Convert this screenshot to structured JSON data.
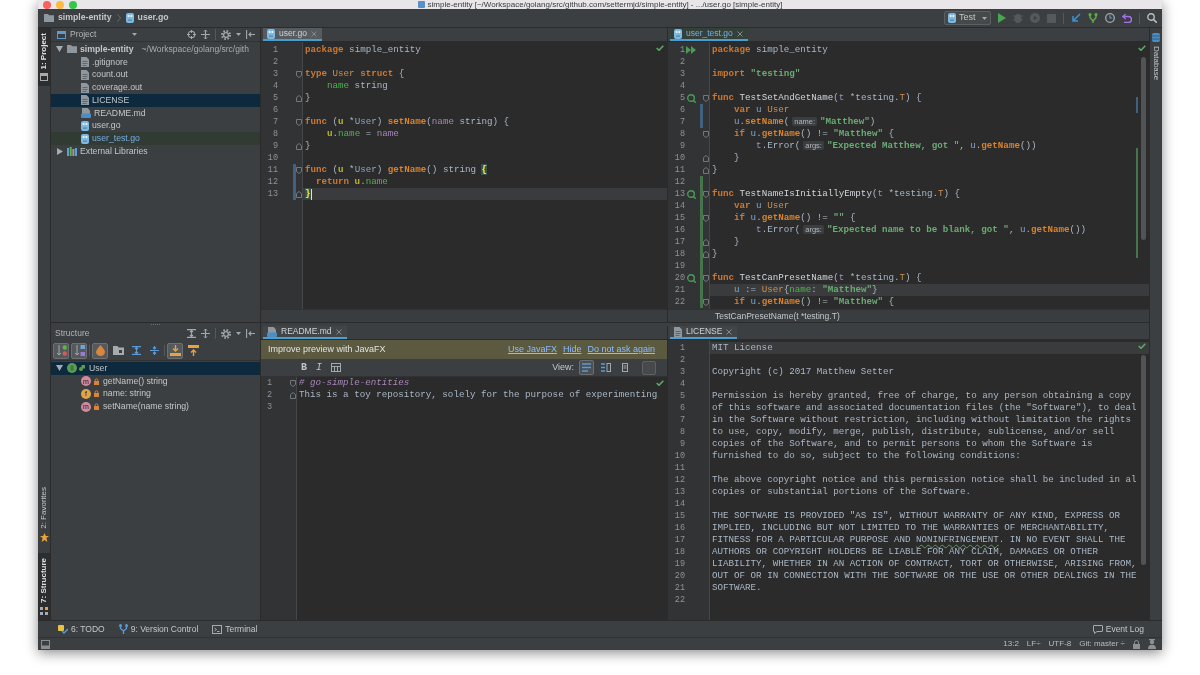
{
  "window": {
    "title": "simple-entity [~/Workspace/golang/src/github.com/settermjd/simple-entity] - .../user.go [simple-entity]"
  },
  "navigation_bar": {
    "breadcrumbs": [
      {
        "label": "simple-entity",
        "kind": "folder"
      },
      {
        "label": "user.go",
        "kind": "go"
      }
    ],
    "run_configuration": {
      "label": "Test"
    }
  },
  "left_stripe": [
    {
      "label": "1: Project",
      "selected": true
    },
    {
      "label": "2: Favorites",
      "selected": false
    },
    {
      "label": "7: Structure",
      "selected": true
    }
  ],
  "right_stripe": [
    {
      "label": "Database",
      "selected": false
    }
  ],
  "project": {
    "title": "Project",
    "tree": [
      {
        "label": "simple-entity",
        "kind": "folder",
        "path": "~/Workspace/golang/src/gith",
        "expanded": true,
        "selected": false,
        "children": [
          {
            "label": ".gitignore",
            "kind": "text",
            "selected": false,
            "modified": false,
            "test": false
          },
          {
            "label": "count.out",
            "kind": "text",
            "selected": false,
            "modified": false,
            "test": false
          },
          {
            "label": "coverage.out",
            "kind": "text",
            "selected": false,
            "modified": false,
            "test": false
          },
          {
            "label": "LICENSE",
            "kind": "text",
            "selected": true,
            "modified": false,
            "test": false
          },
          {
            "label": "README.md",
            "kind": "markdown",
            "selected": false,
            "modified": false,
            "test": false
          },
          {
            "label": "user.go",
            "kind": "go",
            "selected": false,
            "modified": false,
            "test": false
          },
          {
            "label": "user_test.go",
            "kind": "go",
            "selected": false,
            "modified": true,
            "test": true
          }
        ]
      },
      {
        "label": "External Libraries",
        "kind": "library",
        "expanded": false,
        "selected": false
      }
    ]
  },
  "structure": {
    "title": "Structure",
    "toolbar": [
      {
        "pressed": true
      },
      {
        "pressed": true
      },
      {
        "pressed": true
      },
      {
        "pressed": false
      },
      {
        "pressed": false
      },
      {
        "pressed": false
      },
      {
        "pressed": true
      },
      {
        "pressed": false
      }
    ],
    "tree": [
      {
        "label": "User",
        "kind": "struct",
        "selected": true,
        "expanded": true,
        "children": [
          {
            "label": "getName() string",
            "kind": "method",
            "badge": "m",
            "selected": false
          },
          {
            "label": "name: string",
            "kind": "field",
            "badge": "f",
            "selected": false
          },
          {
            "label": "setName(name string)",
            "kind": "method",
            "badge": "m",
            "selected": false
          }
        ]
      }
    ]
  },
  "editors": [
    {
      "tab": {
        "label": "user.go",
        "kind": "go",
        "selected": true,
        "modified": false,
        "test": false
      },
      "focused": true,
      "lines": [
        {
          "number": "1",
          "current": false,
          "tokens": [
            {
              "kind": "keyword",
              "text": "package"
            },
            {
              "kind": "plain",
              "text": " simple_entity"
            }
          ]
        },
        {
          "number": "2",
          "current": false
        },
        {
          "number": "3",
          "current": false,
          "markers": [
            {
              "kind": "fold_start"
            }
          ],
          "tokens": [
            {
              "kind": "keyword",
              "text": "type"
            },
            {
              "kind": "type_name",
              "text": " User"
            },
            {
              "kind": "keyword",
              "text": " struct"
            },
            {
              "kind": "plain",
              "text": " {"
            }
          ]
        },
        {
          "number": "4",
          "current": false,
          "tokens": [
            {
              "kind": "field",
              "text": "    name"
            },
            {
              "kind": "plain",
              "text": " string"
            }
          ]
        },
        {
          "number": "5",
          "current": false,
          "markers": [
            {
              "kind": "fold_end"
            }
          ],
          "tokens": [
            {
              "kind": "plain",
              "text": "}"
            }
          ]
        },
        {
          "number": "6",
          "current": false
        },
        {
          "number": "7",
          "current": false,
          "markers": [
            {
              "kind": "fold_start"
            }
          ],
          "tokens": [
            {
              "kind": "keyword",
              "text": "func"
            },
            {
              "kind": "plain",
              "text": " ("
            },
            {
              "kind": "receiver",
              "text": "u"
            },
            {
              "kind": "plain",
              "text": " *"
            },
            {
              "kind": "type_ref",
              "text": "User"
            },
            {
              "kind": "plain",
              "text": ") "
            },
            {
              "kind": "method",
              "text": "setName"
            },
            {
              "kind": "plain",
              "text": "("
            },
            {
              "kind": "param",
              "text": "name"
            },
            {
              "kind": "plain",
              "text": " string) {"
            }
          ]
        },
        {
          "number": "8",
          "current": false,
          "tokens": [
            {
              "kind": "receiver",
              "text": "    u"
            },
            {
              "kind": "plain",
              "text": "."
            },
            {
              "kind": "field",
              "text": "name"
            },
            {
              "kind": "plain",
              "text": " = "
            },
            {
              "kind": "param",
              "text": "name"
            }
          ]
        },
        {
          "number": "9",
          "current": false,
          "markers": [
            {
              "kind": "fold_end"
            }
          ],
          "tokens": [
            {
              "kind": "plain",
              "text": "}"
            }
          ]
        },
        {
          "number": "10",
          "current": false
        },
        {
          "number": "11",
          "current": false,
          "markers": [
            {
              "kind": "fold_start"
            },
            {
              "kind": "modified"
            }
          ],
          "tokens": [
            {
              "kind": "keyword",
              "text": "func"
            },
            {
              "kind": "plain",
              "text": " ("
            },
            {
              "kind": "receiver",
              "text": "u"
            },
            {
              "kind": "plain",
              "text": " *"
            },
            {
              "kind": "type_ref",
              "text": "User"
            },
            {
              "kind": "plain",
              "text": ") "
            },
            {
              "kind": "method",
              "text": "getName"
            },
            {
              "kind": "plain",
              "text": "() string "
            },
            {
              "kind": "brace",
              "text": "{"
            }
          ]
        },
        {
          "number": "12",
          "current": false,
          "markers": [
            {
              "kind": "modified"
            }
          ],
          "tokens": [
            {
              "kind": "keyword",
              "text": "  return"
            },
            {
              "kind": "receiver",
              "text": " u"
            },
            {
              "kind": "plain",
              "text": "."
            },
            {
              "kind": "field",
              "text": "name"
            }
          ]
        },
        {
          "number": "13",
          "current": true,
          "markers": [
            {
              "kind": "fold_end"
            },
            {
              "kind": "modified"
            }
          ],
          "tokens": [
            {
              "kind": "brace",
              "text": "}"
            }
          ]
        }
      ]
    },
    {
      "tab": {
        "label": "user_test.go",
        "kind": "go",
        "selected": true,
        "modified": true,
        "test": true
      },
      "focused": false,
      "breadcrumb": "TestCanPresetName(t *testing.T)",
      "lines": [
        {
          "number": "1",
          "current": false,
          "markers": [
            {
              "kind": "run_file"
            }
          ],
          "tokens": [
            {
              "kind": "keyword",
              "text": "package"
            },
            {
              "kind": "plain",
              "text": " simple_entity"
            }
          ]
        },
        {
          "number": "2",
          "current": false
        },
        {
          "number": "3",
          "current": false,
          "tokens": [
            {
              "kind": "keyword",
              "text": "import"
            },
            {
              "kind": "string",
              "text": " \"testing\""
            }
          ]
        },
        {
          "number": "4",
          "current": false
        },
        {
          "number": "5",
          "current": false,
          "markers": [
            {
              "kind": "run_test"
            },
            {
              "kind": "fold_start"
            }
          ],
          "tokens": [
            {
              "kind": "keyword",
              "text": "func"
            },
            {
              "kind": "func",
              "text": " TestSetAndGetName"
            },
            {
              "kind": "plain",
              "text": "("
            },
            {
              "kind": "param",
              "text": "t"
            },
            {
              "kind": "plain",
              "text": " *testing."
            },
            {
              "kind": "type_name",
              "text": "T"
            },
            {
              "kind": "plain",
              "text": ") {"
            }
          ]
        },
        {
          "number": "6",
          "current": false,
          "markers": [
            {
              "kind": "modified"
            }
          ],
          "tokens": [
            {
              "kind": "keyword",
              "text": "    var"
            },
            {
              "kind": "local",
              "text": " u"
            },
            {
              "kind": "type_name",
              "text": " User"
            }
          ]
        },
        {
          "number": "7",
          "current": false,
          "markers": [
            {
              "kind": "modified"
            }
          ],
          "tokens": [
            {
              "kind": "local",
              "text": "    u"
            },
            {
              "kind": "plain",
              "text": "."
            },
            {
              "kind": "method",
              "text": "setName"
            },
            {
              "kind": "plain",
              "text": "("
            },
            {
              "kind": "hint",
              "text": "name:"
            },
            {
              "kind": "string",
              "text": "\"Matthew\""
            },
            {
              "kind": "plain",
              "text": ")"
            }
          ]
        },
        {
          "number": "8",
          "current": false,
          "markers": [
            {
              "kind": "fold_start"
            }
          ],
          "tokens": [
            {
              "kind": "keyword",
              "text": "    if"
            },
            {
              "kind": "local",
              "text": " u"
            },
            {
              "kind": "plain",
              "text": "."
            },
            {
              "kind": "method",
              "text": "getName"
            },
            {
              "kind": "plain",
              "text": "() != "
            },
            {
              "kind": "string",
              "text": "\"Matthew\""
            },
            {
              "kind": "plain",
              "text": " {"
            }
          ]
        },
        {
          "number": "9",
          "current": false,
          "tokens": [
            {
              "kind": "param",
              "text": "        t"
            },
            {
              "kind": "plain",
              "text": ".Error("
            },
            {
              "kind": "hint",
              "text": "args:"
            },
            {
              "kind": "string",
              "text": "\"Expected Matthew, got \""
            },
            {
              "kind": "plain",
              "text": ", "
            },
            {
              "kind": "local",
              "text": "u"
            },
            {
              "kind": "plain",
              "text": "."
            },
            {
              "kind": "method",
              "text": "getName"
            },
            {
              "kind": "plain",
              "text": "())"
            }
          ]
        },
        {
          "number": "10",
          "current": false,
          "markers": [
            {
              "kind": "fold_end"
            }
          ],
          "tokens": [
            {
              "kind": "plain",
              "text": "    }"
            }
          ]
        },
        {
          "number": "11",
          "current": false,
          "markers": [
            {
              "kind": "fold_end"
            }
          ],
          "tokens": [
            {
              "kind": "plain",
              "text": "}"
            }
          ]
        },
        {
          "number": "12",
          "current": false,
          "markers": [
            {
              "kind": "added"
            }
          ]
        },
        {
          "number": "13",
          "current": false,
          "markers": [
            {
              "kind": "run_test"
            },
            {
              "kind": "added"
            },
            {
              "kind": "fold_start"
            }
          ],
          "tokens": [
            {
              "kind": "keyword",
              "text": "func"
            },
            {
              "kind": "func",
              "text": " TestNameIsInitiallyEmpty"
            },
            {
              "kind": "plain",
              "text": "("
            },
            {
              "kind": "param",
              "text": "t"
            },
            {
              "kind": "plain",
              "text": " *testing."
            },
            {
              "kind": "type_name",
              "text": "T"
            },
            {
              "kind": "plain",
              "text": ") {"
            }
          ]
        },
        {
          "number": "14",
          "current": false,
          "markers": [
            {
              "kind": "added"
            }
          ],
          "tokens": [
            {
              "kind": "keyword",
              "text": "    var"
            },
            {
              "kind": "local",
              "text": " u"
            },
            {
              "kind": "type_name",
              "text": " User"
            }
          ]
        },
        {
          "number": "15",
          "current": false,
          "markers": [
            {
              "kind": "added"
            },
            {
              "kind": "fold_start"
            }
          ],
          "tokens": [
            {
              "kind": "keyword",
              "text": "    if"
            },
            {
              "kind": "local",
              "text": " u"
            },
            {
              "kind": "plain",
              "text": "."
            },
            {
              "kind": "method",
              "text": "getName"
            },
            {
              "kind": "plain",
              "text": "() != "
            },
            {
              "kind": "string",
              "text": "\"\""
            },
            {
              "kind": "plain",
              "text": " {"
            }
          ]
        },
        {
          "number": "16",
          "current": false,
          "markers": [
            {
              "kind": "added"
            }
          ],
          "tokens": [
            {
              "kind": "param",
              "text": "        t"
            },
            {
              "kind": "plain",
              "text": ".Error("
            },
            {
              "kind": "hint",
              "text": "args:"
            },
            {
              "kind": "string",
              "text": "\"Expected name to be blank, got \""
            },
            {
              "kind": "plain",
              "text": ", "
            },
            {
              "kind": "local",
              "text": "u"
            },
            {
              "kind": "plain",
              "text": "."
            },
            {
              "kind": "method",
              "text": "getName"
            },
            {
              "kind": "plain",
              "text": "())"
            }
          ]
        },
        {
          "number": "17",
          "current": false,
          "markers": [
            {
              "kind": "added"
            },
            {
              "kind": "fold_end"
            }
          ],
          "tokens": [
            {
              "kind": "plain",
              "text": "    }"
            }
          ]
        },
        {
          "number": "18",
          "current": false,
          "markers": [
            {
              "kind": "added"
            },
            {
              "kind": "fold_end"
            }
          ],
          "tokens": [
            {
              "kind": "plain",
              "text": "}"
            }
          ]
        },
        {
          "number": "19",
          "current": false,
          "markers": [
            {
              "kind": "added"
            }
          ]
        },
        {
          "number": "20",
          "current": false,
          "markers": [
            {
              "kind": "run_test"
            },
            {
              "kind": "added"
            },
            {
              "kind": "fold_start"
            }
          ],
          "tokens": [
            {
              "kind": "keyword",
              "text": "func"
            },
            {
              "kind": "func",
              "text": " TestCanPresetName"
            },
            {
              "kind": "plain",
              "text": "("
            },
            {
              "kind": "param",
              "text": "t"
            },
            {
              "kind": "plain",
              "text": " *testing."
            },
            {
              "kind": "type_name",
              "text": "T"
            },
            {
              "kind": "plain",
              "text": ") {"
            }
          ]
        },
        {
          "number": "21",
          "current": true,
          "markers": [
            {
              "kind": "added"
            }
          ],
          "tokens": [
            {
              "kind": "local",
              "text": "    u"
            },
            {
              "kind": "plain",
              "text": " := "
            },
            {
              "kind": "type_name",
              "text": "User"
            },
            {
              "kind": "plain",
              "text": "{"
            },
            {
              "kind": "field",
              "text": "name"
            },
            {
              "kind": "plain",
              "text": ": "
            },
            {
              "kind": "string",
              "text": "\"Matthew\""
            },
            {
              "kind": "plain",
              "text": "}"
            }
          ]
        },
        {
          "number": "22",
          "current": false,
          "markers": [
            {
              "kind": "added"
            },
            {
              "kind": "fold_start"
            }
          ],
          "tokens": [
            {
              "kind": "keyword",
              "text": "    if"
            },
            {
              "kind": "local",
              "text": " u"
            },
            {
              "kind": "plain",
              "text": "."
            },
            {
              "kind": "method",
              "text": "getName"
            },
            {
              "kind": "plain",
              "text": "() != "
            },
            {
              "kind": "string",
              "text": "\"Matthew\""
            },
            {
              "kind": "plain",
              "text": " {"
            }
          ]
        }
      ]
    },
    {
      "tab": {
        "label": "README.md",
        "kind": "markdown",
        "selected": true,
        "modified": false,
        "test": false
      },
      "focused": false,
      "notification": {
        "message": "Improve preview with JavaFX",
        "links": [
          "Use JavaFX",
          "Hide",
          "Do not ask again"
        ]
      },
      "toolbar": {
        "format_buttons": [
          {
            "label": "B",
            "kind": "bold"
          },
          {
            "label": "I",
            "kind": "italic"
          }
        ],
        "view_label": "View:",
        "view_modes": [
          {
            "selected": true
          },
          {
            "selected": false
          },
          {
            "selected": false
          }
        ]
      },
      "lines": [
        {
          "number": "1",
          "current": false,
          "markers": [
            {
              "kind": "fold_start"
            }
          ],
          "tokens": [
            {
              "kind": "heading",
              "text": "# go-simple-entities"
            }
          ]
        },
        {
          "number": "2",
          "current": false,
          "markers": [
            {
              "kind": "fold_end"
            }
          ],
          "text": "This is a toy repository, solely for the purpose of experimenting"
        },
        {
          "number": "3",
          "current": false
        }
      ]
    },
    {
      "tab": {
        "label": "LICENSE",
        "kind": "text",
        "selected": true,
        "modified": false,
        "test": false
      },
      "focused": false,
      "lines": [
        {
          "number": "1",
          "current": true,
          "text": "MIT License"
        },
        {
          "number": "2",
          "current": false
        },
        {
          "number": "3",
          "current": false,
          "text": "Copyright (c) 2017 Matthew Setter"
        },
        {
          "number": "4",
          "current": false
        },
        {
          "number": "5",
          "current": false,
          "text": "Permission is hereby granted, free of charge, to any person obtaining a copy"
        },
        {
          "number": "6",
          "current": false,
          "text": "of this software and associated documentation files (the \"Software\"), to deal"
        },
        {
          "number": "7",
          "current": false,
          "text": "in the Software without restriction, including without limitation the rights"
        },
        {
          "number": "8",
          "current": false,
          "text": "to use, copy, modify, merge, publish, distribute, sublicense, and/or sell"
        },
        {
          "number": "9",
          "current": false,
          "text": "copies of the Software, and to permit persons to whom the Software is"
        },
        {
          "number": "10",
          "current": false,
          "text": "furnished to do so, subject to the following conditions:"
        },
        {
          "number": "11",
          "current": false
        },
        {
          "number": "12",
          "current": false,
          "text": "The above copyright notice and this permission notice shall be included in al"
        },
        {
          "number": "13",
          "current": false,
          "text": "copies or substantial portions of the Software."
        },
        {
          "number": "14",
          "current": false
        },
        {
          "number": "15",
          "current": false,
          "text": "THE SOFTWARE IS PROVIDED \"AS IS\", WITHOUT WARRANTY OF ANY KIND, EXPRESS OR"
        },
        {
          "number": "16",
          "current": false,
          "text": "IMPLIED, INCLUDING BUT NOT LIMITED TO THE WARRANTIES OF MERCHANTABILITY,"
        },
        {
          "number": "17",
          "current": false,
          "tokens": [
            {
              "kind": "plain",
              "text": "FITNESS FOR A PARTICULAR PURPOSE AND "
            },
            {
              "kind": "typo",
              "text": "NONINFRINGEMENT"
            },
            {
              "kind": "plain",
              "text": ". IN NO EVENT SHALL THE"
            }
          ]
        },
        {
          "number": "18",
          "current": false,
          "text": "AUTHORS OR COPYRIGHT HOLDERS BE LIABLE FOR ANY CLAIM, DAMAGES OR OTHER"
        },
        {
          "number": "19",
          "current": false,
          "text": "LIABILITY, WHETHER IN AN ACTION OF CONTRACT, TORT OR OTHERWISE, ARISING FROM,"
        },
        {
          "number": "20",
          "current": false,
          "text": "OUT OF OR IN CONNECTION WITH THE SOFTWARE OR THE USE OR OTHER DEALINGS IN THE"
        },
        {
          "number": "21",
          "current": false,
          "text": "SOFTWARE."
        },
        {
          "number": "22",
          "current": false
        }
      ]
    }
  ],
  "tool_windows": [
    {
      "label": "6: TODO"
    },
    {
      "label": "9: Version Control"
    },
    {
      "label": "Terminal"
    }
  ],
  "event_log": {
    "label": "Event Log"
  },
  "status_bar": {
    "position": "13:2",
    "line_separator": "LF÷",
    "encoding": "UTF-8",
    "vcs_branch": "Git: master ÷"
  }
}
